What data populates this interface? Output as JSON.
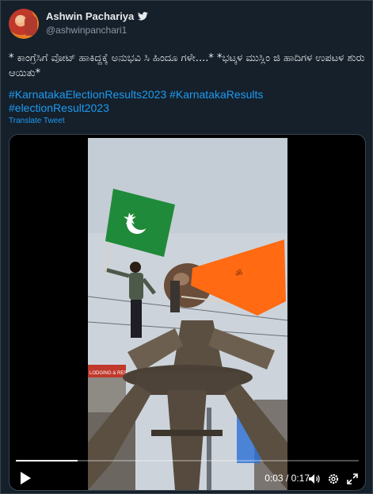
{
  "author": {
    "name": "Ashwin Pachariya",
    "handle": "@ashwinpanchari1",
    "verified_icon": "twitter-bird-icon"
  },
  "tweet": {
    "text": "* ಕಾಂಗ್ರೆಸಿಗೆ ವೋಟ್ ಹಾಕಿದ್ದಕ್ಕೆ ಅನುಭವಿ ಸಿ ಹಿಂದೂ ಗಳೇ....* *ಭಟ್ಕಳ ಮುಸ್ಲಿಂ ಜಿ ಹಾದಿಗಳ ಉಪಟಳ ಶುರು ಆಯಿತು*",
    "hashtags": [
      "#KarnatakaElectionResults2023",
      "#KarnatakaResults",
      "#electionResult2023"
    ],
    "translate_label": "Translate Tweet"
  },
  "video": {
    "time_current": "0:03",
    "time_separator": "/",
    "time_total": "0:17",
    "progress_fraction": 0.18,
    "sign_text": "LODGING & RES",
    "controls": [
      "play-icon",
      "volume-icon",
      "settings-icon",
      "fullscreen-icon"
    ]
  },
  "colors": {
    "background": "#15202b",
    "link": "#1d9bf0",
    "muted": "#8b98a5",
    "green_flag": "#1f8a3a",
    "saffron_flag": "#ff6a13"
  }
}
